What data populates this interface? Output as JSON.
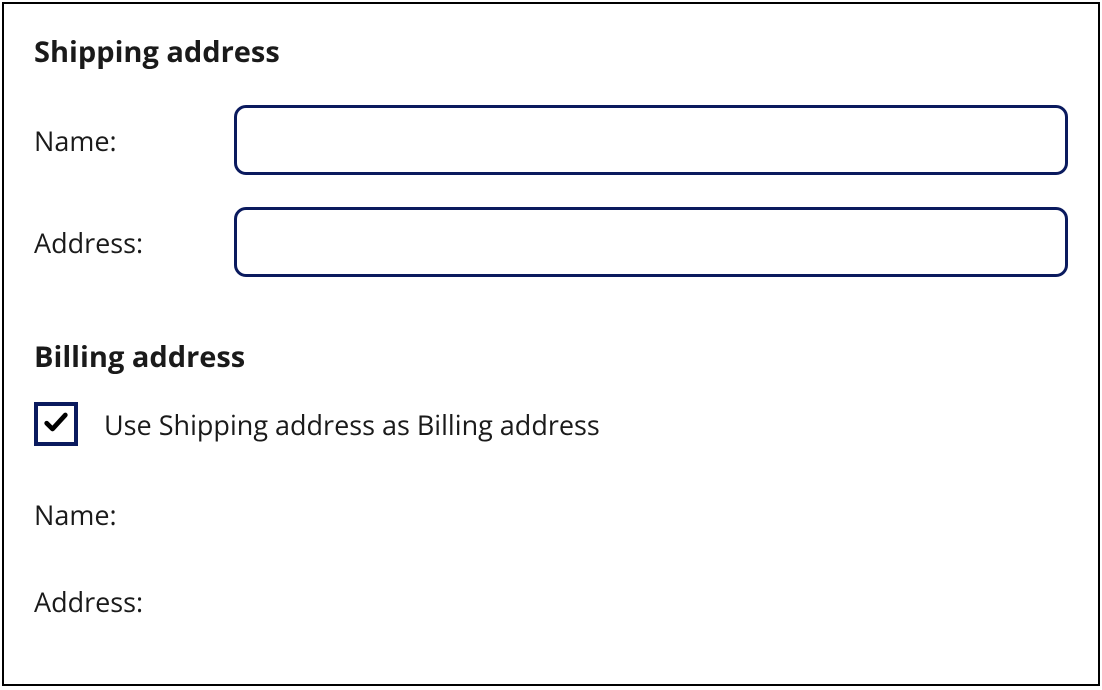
{
  "shipping": {
    "title": "Shipping address",
    "name_label": "Name:",
    "name_value": "",
    "address_label": "Address:",
    "address_value": ""
  },
  "billing": {
    "title": "Billing address",
    "use_shipping_label": "Use Shipping address as Billing address",
    "use_shipping_checked": true,
    "name_label": "Name:",
    "address_label": "Address:"
  }
}
